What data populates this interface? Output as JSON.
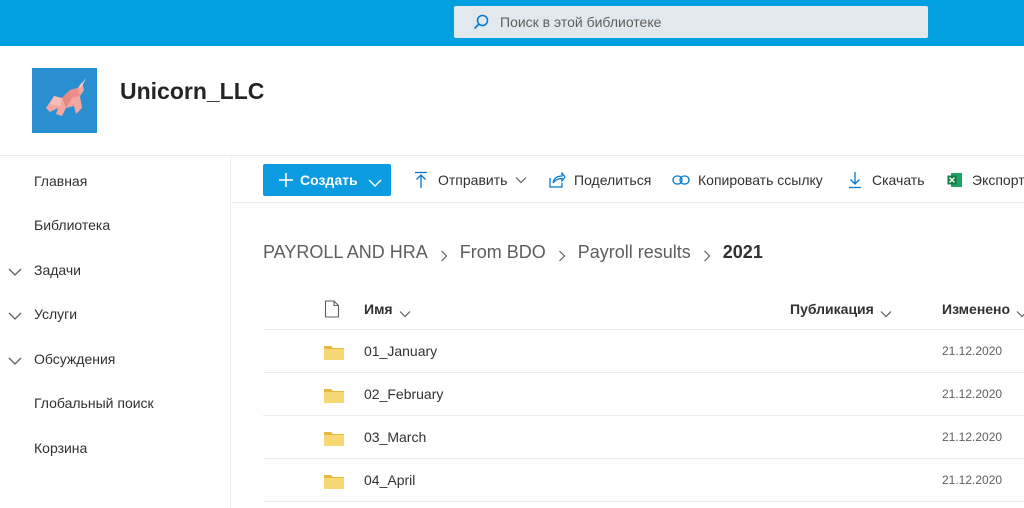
{
  "search": {
    "placeholder": "Поиск в этой библиотеке"
  },
  "site": {
    "title": "Unicorn_LLC"
  },
  "nav": {
    "items": [
      {
        "label": "Главная",
        "expandable": false
      },
      {
        "label": "Библиотека",
        "expandable": false
      },
      {
        "label": "Задачи",
        "expandable": true
      },
      {
        "label": "Услуги",
        "expandable": true
      },
      {
        "label": "Обсуждения",
        "expandable": true
      },
      {
        "label": "Глобальный поиск",
        "expandable": false
      },
      {
        "label": "Корзина",
        "expandable": false
      }
    ]
  },
  "commands": {
    "new_label": "Создать",
    "upload_label": "Отправить",
    "share_label": "Поделиться",
    "copy_link_label": "Копировать ссылку",
    "download_label": "Скачать",
    "export_label": "Экспорт"
  },
  "breadcrumb": {
    "items": [
      "PAYROLL AND HRA",
      "From BDO",
      "Payroll results"
    ],
    "current": "2021"
  },
  "columns": {
    "name": "Имя",
    "publication": "Публикация",
    "modified": "Изменено"
  },
  "rows": [
    {
      "name": "01_January",
      "modified": "21.12.2020"
    },
    {
      "name": "02_February",
      "modified": "21.12.2020"
    },
    {
      "name": "03_March",
      "modified": "21.12.2020"
    },
    {
      "name": "04_April",
      "modified": "21.12.2020"
    }
  ],
  "colors": {
    "topbar": "#03a0e1",
    "primary_button": "#0b9be0",
    "folder": "#f8d775",
    "accent": "#0078d4"
  }
}
